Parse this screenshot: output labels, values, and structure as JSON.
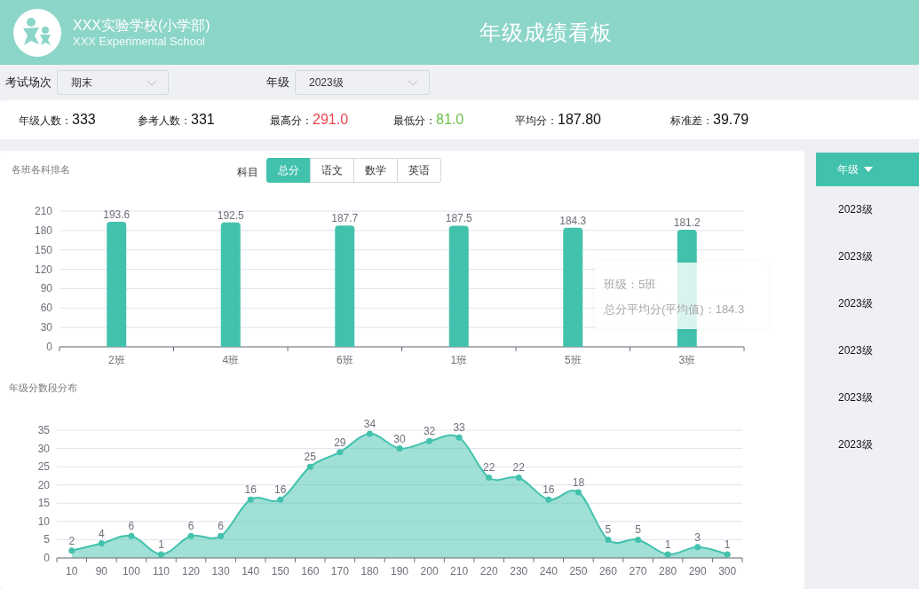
{
  "header": {
    "school_name": "XXX实验学校(小学部)",
    "school_name_en": "XXX Experimental School",
    "title": "年级成绩看板"
  },
  "filters": [
    {
      "label": "考试场次",
      "value": "期末"
    },
    {
      "label": "年级",
      "value": "2023级"
    }
  ],
  "stats": [
    {
      "label": "年级人数：",
      "value": "333",
      "color": "#111111"
    },
    {
      "label": "参考人数：",
      "value": "331",
      "color": "#111111"
    },
    {
      "label": "最高分：",
      "value": "291.0",
      "color": "#e8464f"
    },
    {
      "label": "最低分：",
      "value": "81.0",
      "color": "#6cc04a"
    },
    {
      "label": "平均分：",
      "value": "187.80",
      "color": "#111111"
    },
    {
      "label": "标准差：",
      "value": "39.79",
      "color": "#111111"
    }
  ],
  "class_ranking": {
    "title": "各班各科排名",
    "subject_label": "科目",
    "subjects": [
      {
        "label": "总分",
        "selected": true
      },
      {
        "label": "语文",
        "selected": false
      },
      {
        "label": "数学",
        "selected": false
      },
      {
        "label": "英语",
        "selected": false
      }
    ],
    "chart_data": {
      "type": "bar",
      "categories": [
        "2班",
        "4班",
        "6班",
        "1班",
        "5班",
        "3班"
      ],
      "series": [
        {
          "color": "#42c2ad",
          "values": [
            193.6,
            192.5,
            187.7,
            187.5,
            184.3,
            181.2
          ]
        }
      ],
      "ylim": [
        0,
        210
      ],
      "yticks": [
        0,
        30,
        60,
        90,
        120,
        150,
        180,
        210
      ],
      "data_labels": true,
      "grid": true
    },
    "tooltip": {
      "lines": [
        "班级：5班",
        "总分平均分(平均值)：184.3"
      ]
    }
  },
  "distribution": {
    "title": "年级分数段分布",
    "chart_data": {
      "type": "area",
      "categories": [
        "10",
        "90",
        "100",
        "110",
        "120",
        "130",
        "140",
        "150",
        "160",
        "170",
        "180",
        "190",
        "200",
        "210",
        "220",
        "230",
        "240",
        "250",
        "260",
        "270",
        "280",
        "290",
        "300"
      ],
      "series": [
        {
          "color": "#42c2ad",
          "values": [
            2,
            4,
            6,
            1,
            6,
            6,
            16,
            16,
            25,
            29,
            34,
            30,
            32,
            33,
            22,
            22,
            16,
            18,
            5,
            5,
            1,
            3,
            1
          ]
        }
      ],
      "ylim": [
        0,
        35
      ],
      "yticks": [
        0,
        5,
        10,
        15,
        20,
        25,
        30,
        35
      ],
      "data_labels": true,
      "grid": true
    }
  },
  "grade_menu": {
    "header": "年级",
    "items": [
      "2023级",
      "2023级",
      "2023级",
      "2023级",
      "2023级",
      "2023级"
    ]
  }
}
